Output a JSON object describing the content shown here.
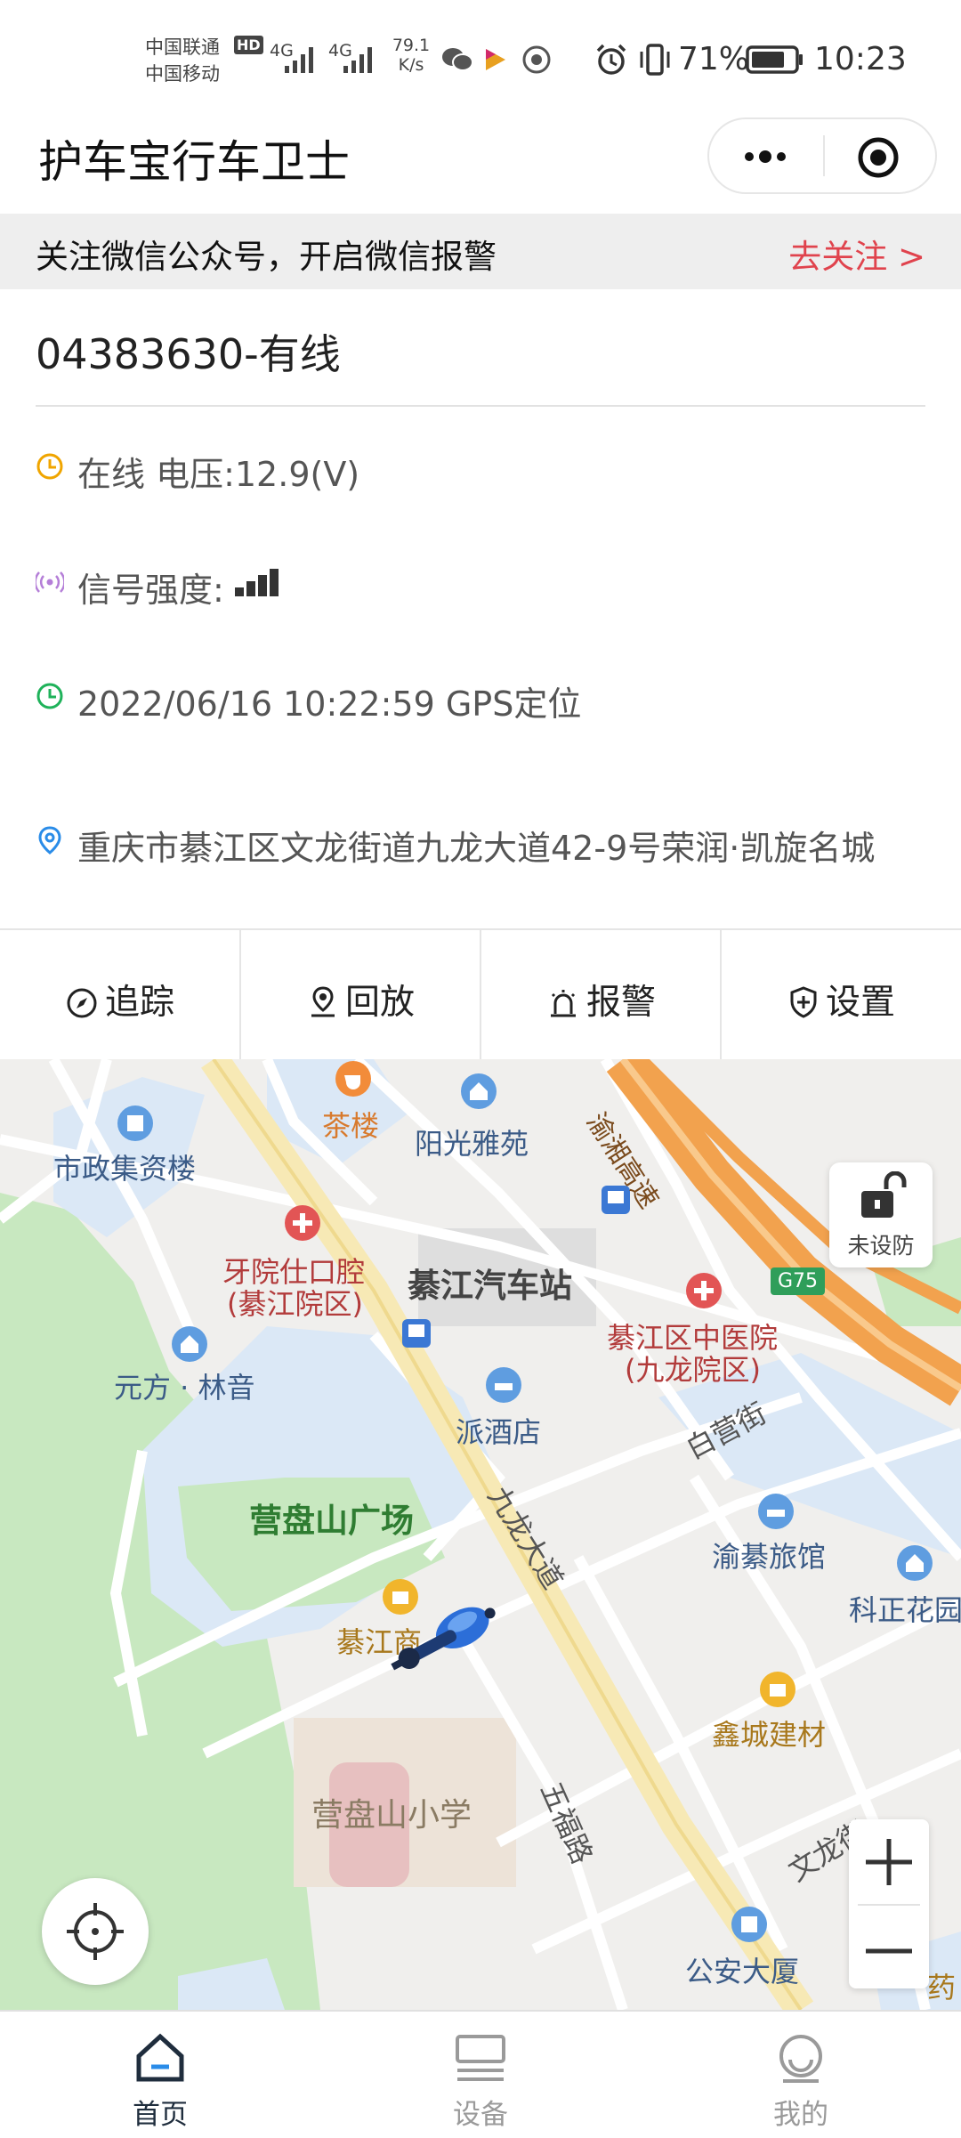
{
  "status_bar": {
    "carrier1": "中国联通",
    "carrier2": "中国移动",
    "hd": "HD",
    "net1": "4G",
    "net2": "4G",
    "speed_value": "79.1",
    "speed_unit": "K/s",
    "battery": "71%",
    "time": "10:23"
  },
  "app": {
    "title": "护车宝行车卫士"
  },
  "notice": {
    "text": "关注微信公众号，开启微信报警",
    "link": "去关注 >"
  },
  "device": {
    "name": "04383630-有线",
    "status": "在线 电压:12.9(V)",
    "signal_label": "信号强度:",
    "signal_bars": 4,
    "time_text": "2022/06/16 10:22:59 GPS定位",
    "address": "重庆市綦江区文龙街道九龙大道42-9号荣润·凯旋名城"
  },
  "tabs": [
    {
      "label": "追踪",
      "icon": "compass-icon"
    },
    {
      "label": "回放",
      "icon": "location-pin-icon"
    },
    {
      "label": "报警",
      "icon": "alarm-icon"
    },
    {
      "label": "设置",
      "icon": "shield-icon"
    }
  ],
  "map": {
    "labels": {
      "chalou": "茶楼",
      "yangguang": "阳光雅苑",
      "shizheng": "市政集资楼",
      "yayuan1": "牙院仕口腔",
      "yayuan2": "(綦江院区)",
      "qijiang_station": "綦江汽车站",
      "highway": "渝湘高速",
      "g75": "G75",
      "zhongyiyuan1": "綦江区中医院",
      "zhongyiyuan2": "(九龙院区)",
      "yuanfang": "元方 · 林音",
      "paijiudian": "派酒店",
      "baiying": "白营街",
      "yingpanshan": "营盘山广场",
      "jiulong": "九龙大道",
      "yuqi": "渝綦旅馆",
      "kezheng": "科正花园",
      "qijiang_shang": "綦江商",
      "xincheng": "鑫城建材",
      "wufu": "五福路",
      "xiaoxue": "营盘山小学",
      "wenlong": "文龙街",
      "gongan": "公安大厦",
      "yao": "药"
    },
    "lock_label": "未设防"
  },
  "bottom_nav": [
    {
      "label": "首页",
      "active": true
    },
    {
      "label": "设备",
      "active": false
    },
    {
      "label": "我的",
      "active": false
    }
  ],
  "colors": {
    "accent_red": "#e0434d",
    "nav_active": "#1f2d3d",
    "nav_inactive": "#9a9a9a",
    "park_green": "#c8e8c0",
    "water_blue": "#dbe8f6",
    "highway_orange": "#f2a24e"
  }
}
